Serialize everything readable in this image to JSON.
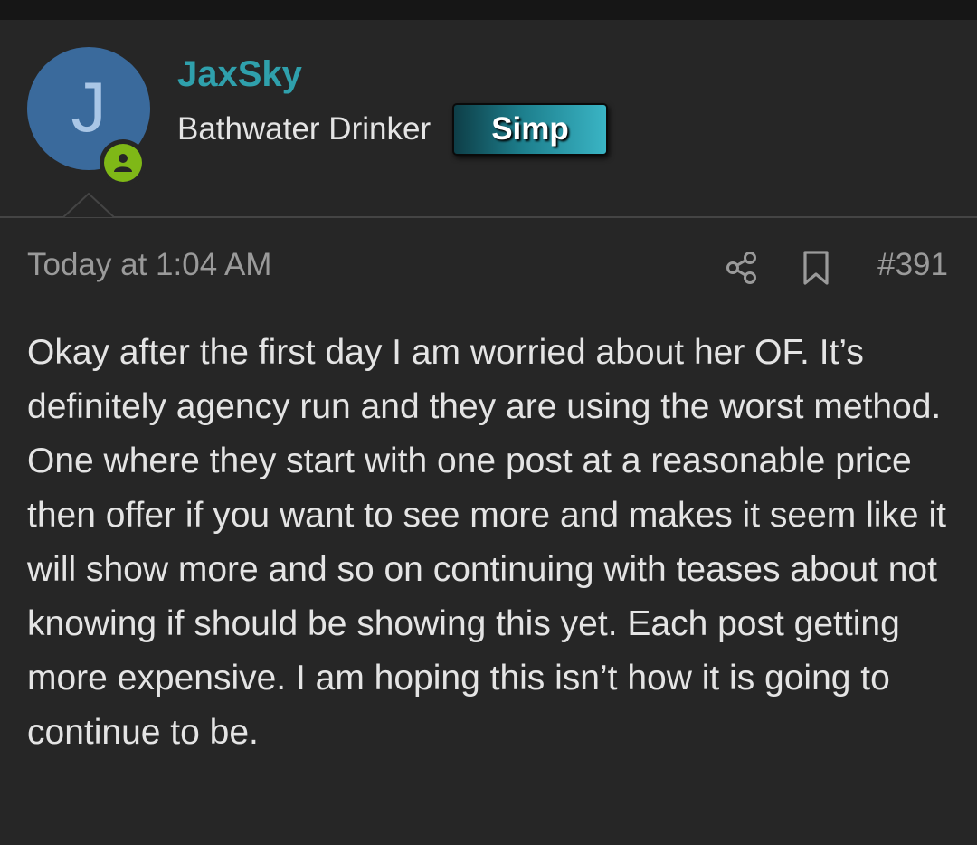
{
  "post": {
    "author": {
      "initial": "J",
      "username": "JaxSky",
      "user_title": "Bathwater Drinker",
      "banner": "Simp",
      "avatar_color": "#3a6a9c",
      "username_color": "#2fa0ac",
      "online_status_color": "#7fb817"
    },
    "timestamp": "Today at 1:04 AM",
    "post_number": "#391",
    "icons": {
      "share": "share-icon",
      "bookmark": "bookmark-icon",
      "online": "user-online-icon"
    },
    "message": "Okay after the first day I am worried about her OF. It’s definitely agency run and they are using the worst method. One where they start with one post at a reasonable price then offer if you want to see more and makes it seem like it will show more and so on continuing with teases about not knowing if should be showing this yet. Each post getting more expensive. I am hoping this isn’t how it is going to continue to be."
  }
}
